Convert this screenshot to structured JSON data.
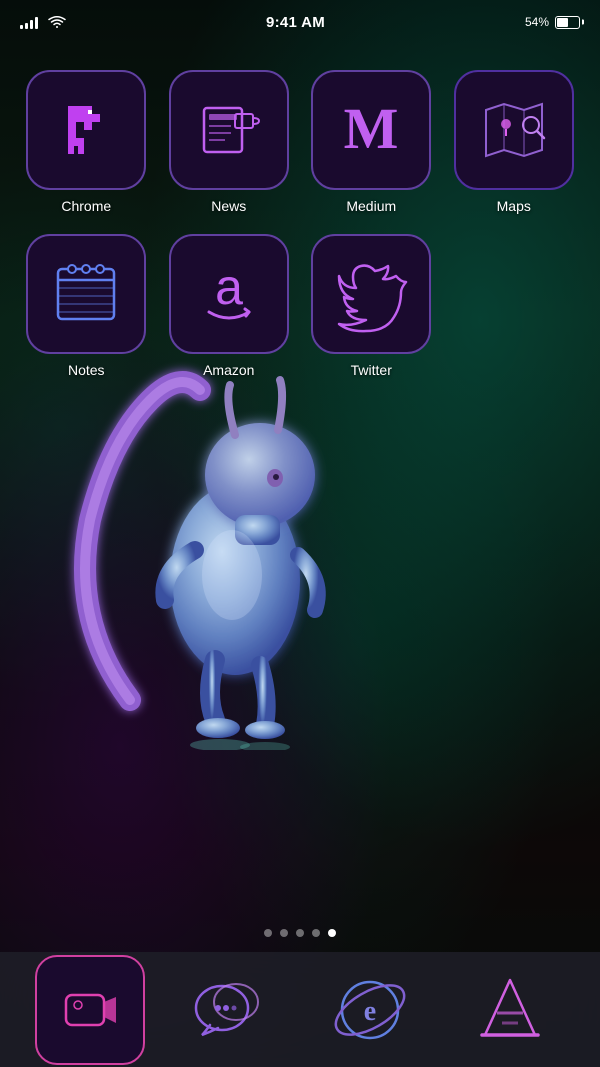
{
  "statusBar": {
    "time": "9:41 AM",
    "battery": "54%",
    "batteryFill": 54
  },
  "apps": [
    {
      "id": "chrome",
      "label": "Chrome",
      "row": 1
    },
    {
      "id": "news",
      "label": "News",
      "row": 1
    },
    {
      "id": "medium",
      "label": "Medium",
      "row": 1
    },
    {
      "id": "maps",
      "label": "Maps",
      "row": 1
    },
    {
      "id": "notes",
      "label": "Notes",
      "row": 2
    },
    {
      "id": "amazon",
      "label": "Amazon",
      "row": 2
    },
    {
      "id": "twitter",
      "label": "Twitter",
      "row": 2
    }
  ],
  "dock": [
    {
      "id": "facetime",
      "label": "FaceTime"
    },
    {
      "id": "messages",
      "label": "Messages"
    },
    {
      "id": "explorer",
      "label": "Explorer"
    },
    {
      "id": "vlc",
      "label": "VLC"
    }
  ],
  "pageDots": [
    0,
    1,
    2,
    3,
    4
  ],
  "activePageDot": 4
}
